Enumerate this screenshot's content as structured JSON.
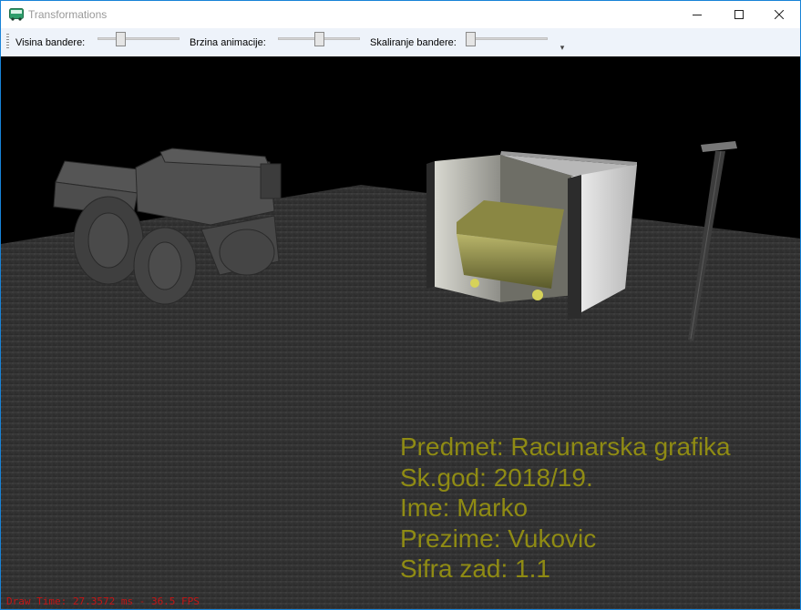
{
  "window": {
    "title": "Transformations",
    "app_icon": "bus-icon"
  },
  "toolbar": {
    "sliders": [
      {
        "label": "Visina bandere:",
        "value": 0.25
      },
      {
        "label": "Brzina animacije:",
        "value": 0.5
      },
      {
        "label": "Skaliranje bandere:",
        "value": 0.0
      }
    ]
  },
  "scene": {
    "info_lines": [
      "Predmet: Racunarska grafika",
      "Sk.god: 2018/19.",
      "Ime: Marko",
      "Prezime: Vukovic",
      "Sifra zad: 1.1"
    ],
    "status": "Draw Time: 27.3572 ms - 36.5 FPS",
    "text_color": "#8f8b14",
    "status_color": "#c41515"
  }
}
